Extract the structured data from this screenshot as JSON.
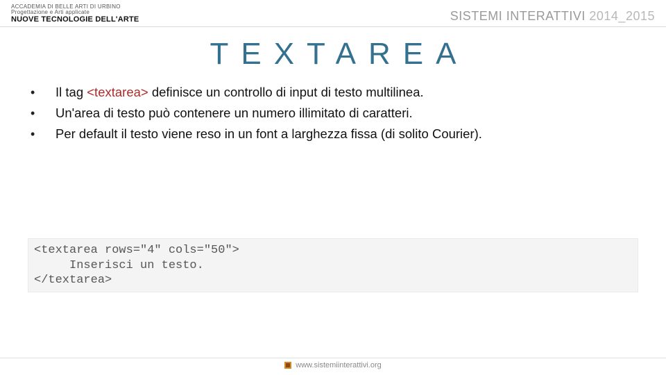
{
  "header": {
    "left_line1": "ACCADEMIA DI BELLE ARTI DI URBINO",
    "left_line2": "Progettazione e Arti applicate",
    "left_line3": "NUOVE TECNOLOGIE DELL'ARTE",
    "right_course": "SISTEMI INTERATTIVI",
    "right_years": "2014_2015"
  },
  "title": "TEXTAREA",
  "bullets": [
    {
      "pre": "Il tag ",
      "tag": "<textarea>",
      "post": " definisce un controllo di input di testo multilinea."
    },
    {
      "pre": "Un'area di testo può contenere un numero illimitato di caratteri.",
      "tag": "",
      "post": ""
    },
    {
      "pre": "Per default il testo viene reso in un font a larghezza fissa (di solito Courier).",
      "tag": "",
      "post": ""
    }
  ],
  "code": {
    "line1": "<textarea rows=\"4\" cols=\"50\">",
    "line2": "     Inserisci un testo.",
    "line3": "</textarea>"
  },
  "footer": {
    "site": "www.sistemiinterattivi.org"
  }
}
